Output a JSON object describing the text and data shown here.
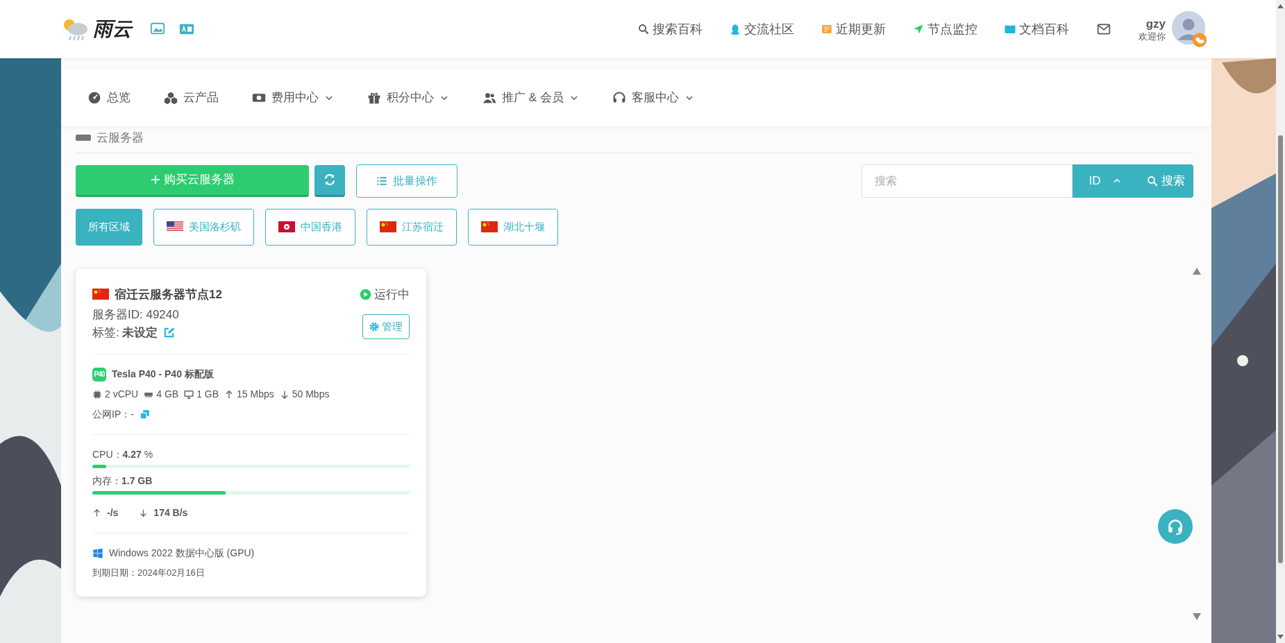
{
  "header": {
    "logo_text": "雨云",
    "nav": [
      {
        "label": "搜索百科"
      },
      {
        "label": "交流社区"
      },
      {
        "label": "近期更新"
      },
      {
        "label": "节点监控"
      },
      {
        "label": "文档百科"
      }
    ],
    "user": {
      "name": "gzy",
      "greeting": "欢迎你"
    }
  },
  "menu": [
    {
      "label": "总览",
      "dropdown": false
    },
    {
      "label": "云产品",
      "dropdown": false
    },
    {
      "label": "费用中心",
      "dropdown": true
    },
    {
      "label": "积分中心",
      "dropdown": true
    },
    {
      "label": "推广 & 会员",
      "dropdown": true
    },
    {
      "label": "客服中心",
      "dropdown": true
    }
  ],
  "section_title": "云服务器",
  "toolbar": {
    "buy_button": "购买云服务器",
    "batch_button": "批量操作",
    "search": {
      "placeholder": "搜索",
      "sort_field": "ID",
      "search_button": "搜索"
    }
  },
  "regions": [
    {
      "label": "所有区域",
      "kind": "all",
      "selected": true
    },
    {
      "label": "美国洛杉矶",
      "kind": "us",
      "selected": false
    },
    {
      "label": "中国香港",
      "kind": "hk",
      "selected": false
    },
    {
      "label": "江苏宿迁",
      "kind": "cn",
      "selected": false
    },
    {
      "label": "湖北十堰",
      "kind": "cn",
      "selected": false
    }
  ],
  "servers": [
    {
      "kind": "cn",
      "name": "宿迁云服务器节点12",
      "status": "运行中",
      "server_id": "服务器ID: 49240",
      "tag": "标签: **未设定**",
      "manage_button": "管理",
      "plan_badge": "P40",
      "plan": "Tesla P40 - P40 标配版",
      "specs": [
        "2 vCPU",
        "4 GB",
        "1 GB",
        "15 Mbps",
        "50 Mbps"
      ],
      "public_ip": "公网IP：-",
      "cpu": {
        "text": "CPU：**4.27** %",
        "level": 0.043
      },
      "memory": {
        "text": "内存：**1.7 GB**",
        "level": 0.42
      },
      "upload": "-/s",
      "download": "174 B/s",
      "os": "Windows 2022 数据中心版 (GPU)",
      "expiry": "到期日期：2024年02月16日"
    }
  ]
}
